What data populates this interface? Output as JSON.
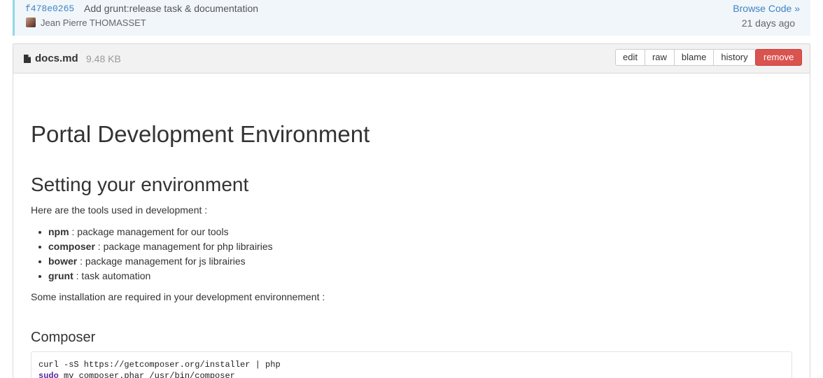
{
  "commit": {
    "sha": "f478e0265",
    "message": "Add grunt:release task & documentation",
    "author": "Jean Pierre THOMASSET",
    "browse_label": "Browse Code »",
    "time": "21 days ago"
  },
  "file": {
    "name": "docs.md",
    "size": "9.48 KB",
    "icon": "file-icon",
    "actions": [
      "edit",
      "raw",
      "blame",
      "history"
    ],
    "remove_label": "remove",
    "colors": {
      "remove": "#d9534f",
      "link": "#4183c4",
      "commit_border": "#92d8e6"
    }
  },
  "content": {
    "title": "Portal Development Environment",
    "section_heading": "Setting your environment",
    "intro": "Here are the tools used in development :",
    "tools": [
      {
        "name": "npm",
        "desc": " : package management for our tools"
      },
      {
        "name": "composer",
        "desc": " : package management for php librairies"
      },
      {
        "name": "bower",
        "desc": " : package management for js librairies"
      },
      {
        "name": "grunt",
        "desc": " : task automation"
      }
    ],
    "install_note": "Some installation are required in your development environnement :",
    "composer_heading": "Composer",
    "code": {
      "line1": "curl -sS https://getcomposer.org/installer | php",
      "line2_keyword": "sudo",
      "line2_rest": " mv composer.phar /usr/bin/composer"
    }
  }
}
